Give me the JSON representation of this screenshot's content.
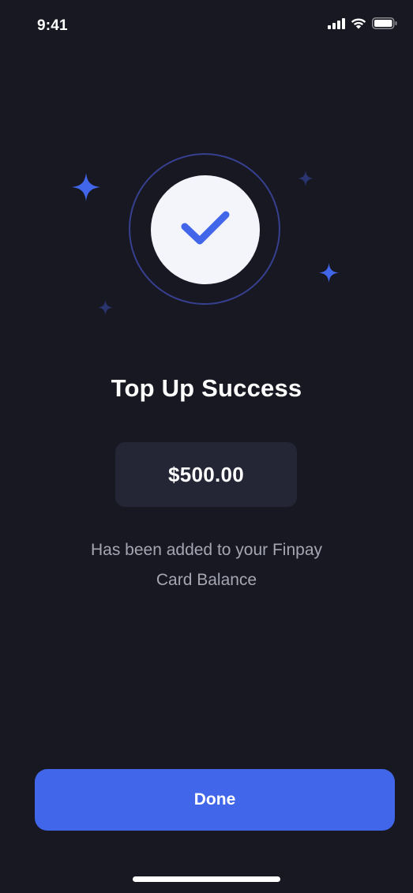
{
  "status_bar": {
    "time": "9:41",
    "icons": [
      "cellular-signal-icon",
      "wifi-icon",
      "battery-icon"
    ]
  },
  "hero": {
    "icon": "checkmark-icon",
    "accent_color": "#4266ea",
    "sparkles": [
      "sparkle-icon",
      "sparkle-icon",
      "sparkle-icon",
      "sparkle-icon"
    ]
  },
  "result": {
    "title": "Top Up Success",
    "amount": "$500.00",
    "message_line1": "Has been added to your Finpay",
    "message_line2": "Card Balance"
  },
  "actions": {
    "done_label": "Done"
  },
  "colors": {
    "background": "#181823",
    "card": "#242535",
    "primary": "#4266ea"
  }
}
